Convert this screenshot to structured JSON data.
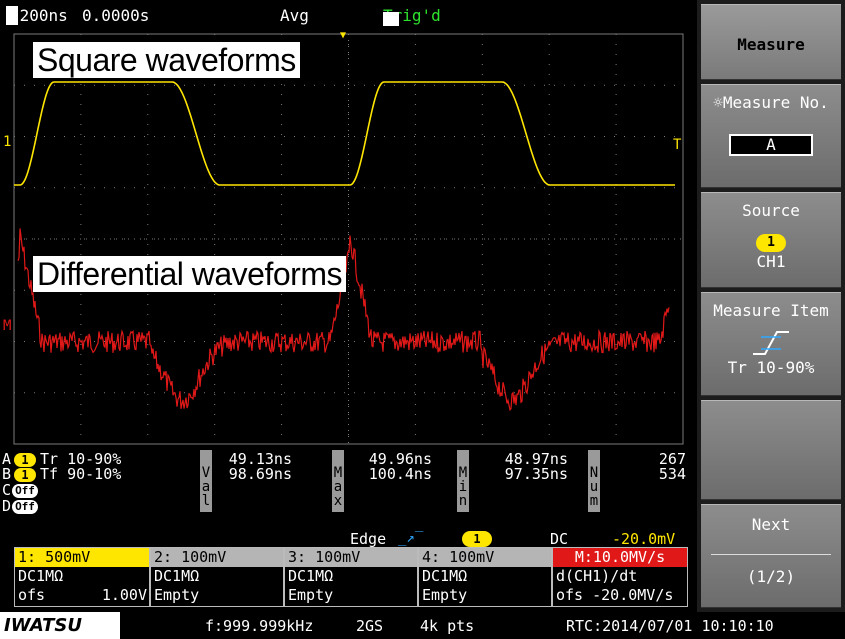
{
  "topbar": {
    "timebase_marker": "M",
    "timebase": "200ns",
    "delay": "0.0000s",
    "acquisition": "Avg",
    "trigger_status": "Trig'd"
  },
  "screen": {
    "ch1_marker": "1",
    "math_marker": "M",
    "trigger_marker": "T",
    "square_label": "Square waveforms",
    "differential_label": "Differential waveforms"
  },
  "measurements": {
    "rows": [
      {
        "slot": "A",
        "channel": "1",
        "item": "Tr 10-90%",
        "value": "49.13ns",
        "max": "49.96ns",
        "min": "48.97ns",
        "num": "267"
      },
      {
        "slot": "B",
        "channel": "1",
        "item": "Tf 90-10%",
        "value": "98.69ns",
        "max": "100.4ns",
        "min": "97.35ns",
        "num": "534"
      },
      {
        "slot": "C",
        "channel": "Off"
      },
      {
        "slot": "D",
        "channel": "Off"
      }
    ],
    "col_val": "Val",
    "col_max": "Max",
    "col_min": "Min",
    "col_num": "Num"
  },
  "trigger": {
    "type": "Edge",
    "source": "1",
    "coupling": "DC",
    "level": "-20.0mV"
  },
  "channels": [
    {
      "header": "1: 500mV",
      "coupling": "DC1MΩ",
      "line2_label": "ofs",
      "line2_value": "1.00V"
    },
    {
      "header": "2: 100mV",
      "coupling": "DC1MΩ",
      "line2_label": "Empty",
      "line2_value": ""
    },
    {
      "header": "3: 100mV",
      "coupling": "DC1MΩ",
      "line2_label": "Empty",
      "line2_value": ""
    },
    {
      "header": "4: 100mV",
      "coupling": "DC1MΩ",
      "line2_label": "Empty",
      "line2_value": ""
    }
  ],
  "math": {
    "header": "M:10.0MV/s",
    "function": "d(CH1)/dt",
    "offset": "ofs -20.0MV/s"
  },
  "bottombar": {
    "brand": "IWATSU",
    "frequency": "f:999.999kHz",
    "sample_rate": "2GS",
    "record_length": "4k pts",
    "rtc": "RTC:2014/07/01 10:10:10"
  },
  "menu": {
    "title": "Measure",
    "measure_no_label": "Measure No.",
    "measure_no_value": "A",
    "source_label": "Source",
    "source_channel": "1",
    "source_name": "CH1",
    "item_label": "Measure Item",
    "item_value": "Tr 10-90%",
    "next_label": "Next",
    "page": "(1/2)"
  },
  "colors": {
    "ch1": "#ffe600",
    "math": "#e01818",
    "trigger": "#2de22d",
    "grid": "#7a7a7a"
  }
}
